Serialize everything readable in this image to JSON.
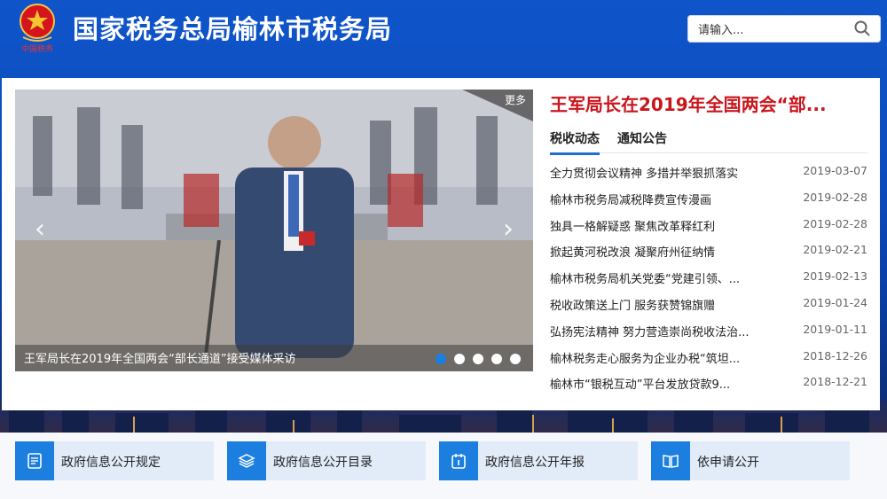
{
  "header": {
    "site_title": "国家税务总局榆林市税务局",
    "emblem_text": "中国税务"
  },
  "search": {
    "placeholder": "请输入..."
  },
  "carousel": {
    "more_label": "更多",
    "caption": "王军局长在2019年全国两会“部长通道”接受媒体采访",
    "dots": 5,
    "active_dot": 1
  },
  "news": {
    "headline": "王军局长在2019年全国两会“部...",
    "tabs": [
      {
        "label": "税收动态",
        "active": true
      },
      {
        "label": "通知公告",
        "active": false
      }
    ],
    "items": [
      {
        "title": "全力贯彻会议精神 多措并举狠抓落实",
        "date": "2019-03-07"
      },
      {
        "title": "榆林市税务局减税降费宣传漫画",
        "date": "2019-02-28"
      },
      {
        "title": "独具一格解疑惑 聚焦改革释红利",
        "date": "2019-02-28"
      },
      {
        "title": "掀起黄河税改浪 凝聚府州征纳情",
        "date": "2019-02-21"
      },
      {
        "title": "榆林市税务局机关党委“党建引领、...",
        "date": "2019-02-13"
      },
      {
        "title": "税收政策送上门 服务获赞锦旗赠",
        "date": "2019-01-24"
      },
      {
        "title": "弘扬宪法精神 努力营造崇尚税收法治...",
        "date": "2019-01-11"
      },
      {
        "title": "榆林税务走心服务为企业办税“筑坦...",
        "date": "2018-12-26"
      },
      {
        "title": "榆林市“银税互动”平台发放贷款9...",
        "date": "2018-12-21"
      }
    ]
  },
  "quick_links": [
    {
      "label": "政府信息公开规定",
      "icon": "document-icon"
    },
    {
      "label": "政府信息公开目录",
      "icon": "layers-icon"
    },
    {
      "label": "政府信息公开年报",
      "icon": "calendar-icon"
    },
    {
      "label": "依申请公开",
      "icon": "book-icon"
    }
  ],
  "colors": {
    "header_blue": "#0f55c9",
    "accent_blue": "#1c7fe0",
    "headline_red": "#c9161c"
  }
}
